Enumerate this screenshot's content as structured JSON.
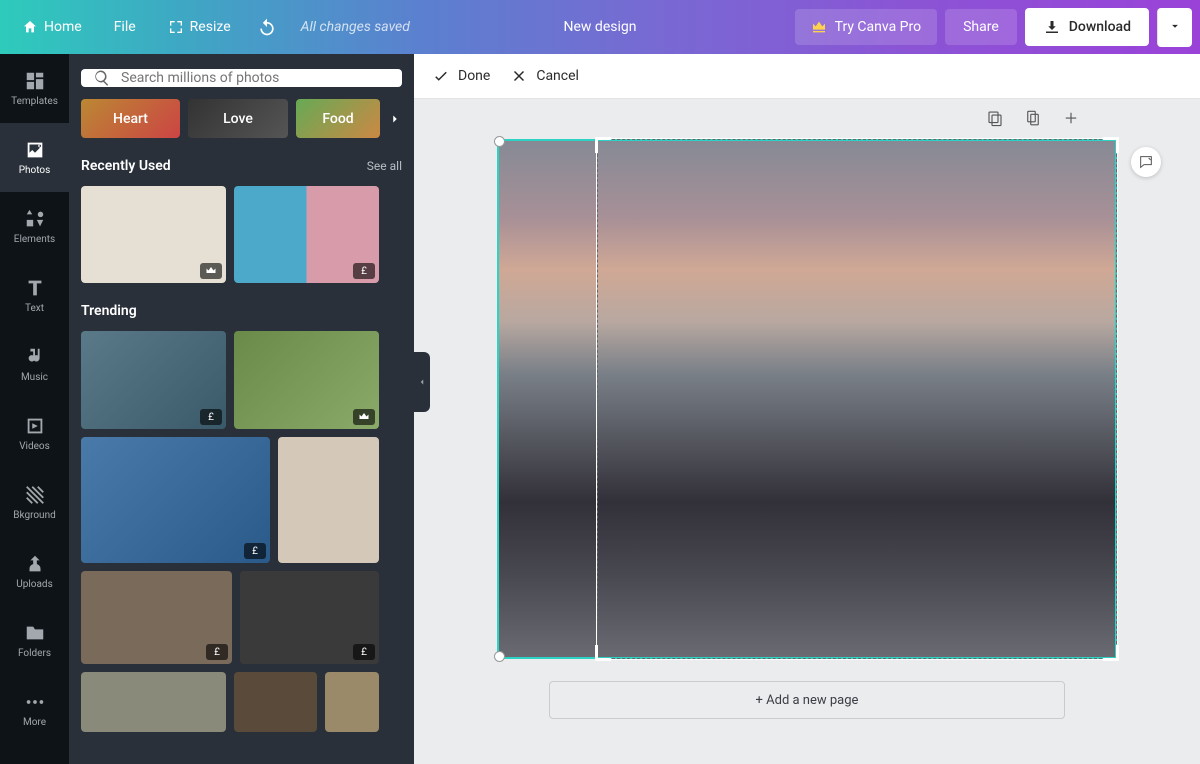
{
  "topbar": {
    "home": "Home",
    "file": "File",
    "resize": "Resize",
    "saved_status": "All changes saved",
    "new_design": "New design",
    "try_pro": "Try Canva Pro",
    "share": "Share",
    "download": "Download"
  },
  "strip": {
    "templates": "Templates",
    "photos": "Photos",
    "elements": "Elements",
    "text": "Text",
    "music": "Music",
    "videos": "Videos",
    "background": "Bkground",
    "uploads": "Uploads",
    "folders": "Folders",
    "more": "More"
  },
  "panel": {
    "search_placeholder": "Search millions of photos",
    "chips": {
      "heart": "Heart",
      "love": "Love",
      "food": "Food"
    },
    "recently_used": "Recently Used",
    "see_all": "See all",
    "trending": "Trending",
    "badge_pound": "£"
  },
  "actions": {
    "done": "Done",
    "cancel": "Cancel"
  },
  "canvas": {
    "add_page": "+ Add a new page"
  }
}
